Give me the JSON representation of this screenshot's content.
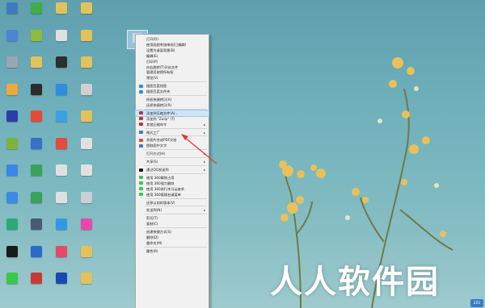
{
  "desktop": {
    "icons": [
      {
        "label": "",
        "color": "#3f7ac0"
      },
      {
        "label": "",
        "color": "#3fae4a"
      },
      {
        "label": "",
        "color": "#e3c25c"
      },
      {
        "label": "",
        "color": "#e3c25c"
      },
      {
        "label": "",
        "color": "#4b86cf"
      },
      {
        "label": "",
        "color": "#8bbd3a"
      },
      {
        "label": "",
        "color": "#e0e0e0"
      },
      {
        "label": "",
        "color": "#e3c25c"
      },
      {
        "label": "",
        "color": "#9aa6b4"
      },
      {
        "label": "",
        "color": "#e3c25c"
      },
      {
        "label": "",
        "color": "#2e2e2e"
      },
      {
        "label": "",
        "color": "#e3c25c"
      },
      {
        "label": "",
        "color": "#f0a73a"
      },
      {
        "label": "",
        "color": "#2b2b2b"
      },
      {
        "label": "",
        "color": "#2d8de0"
      },
      {
        "label": "",
        "color": "#d0d0d0"
      },
      {
        "label": "",
        "color": "#2b3ea8"
      },
      {
        "label": "",
        "color": "#e64a3a"
      },
      {
        "label": "",
        "color": "#3aa0e6"
      },
      {
        "label": "",
        "color": "#e3c25c"
      },
      {
        "label": "",
        "color": "#7fb43a"
      },
      {
        "label": "",
        "color": "#3a70c8"
      },
      {
        "label": "",
        "color": "#e64a3a"
      },
      {
        "label": "",
        "color": "#e0e0e0"
      },
      {
        "label": "",
        "color": "#3a86e6"
      },
      {
        "label": "",
        "color": "#3aa05a"
      },
      {
        "label": "",
        "color": "#e0e0e0"
      },
      {
        "label": "",
        "color": "#e0e0e0"
      },
      {
        "label": "",
        "color": "#3a8ae6"
      },
      {
        "label": "",
        "color": "#3aa05a"
      },
      {
        "label": "",
        "color": "#e0e0e0"
      },
      {
        "label": "",
        "color": "#c8cfd8"
      },
      {
        "label": "",
        "color": "#2ea878"
      },
      {
        "label": "",
        "color": "#4a5a70"
      },
      {
        "label": "",
        "color": "#2e9ae6"
      },
      {
        "label": "",
        "color": "#e64aa8"
      },
      {
        "label": "",
        "color": "#1a1a1a"
      },
      {
        "label": "",
        "color": "#2a6ac8"
      },
      {
        "label": "",
        "color": "#e64a6a"
      },
      {
        "label": "",
        "color": "#e3c25c"
      },
      {
        "label": "",
        "color": "#3ac84a"
      },
      {
        "label": "",
        "color": "#c83a3a"
      },
      {
        "label": "",
        "color": "#1a4ab0"
      },
      {
        "label": "",
        "color": "#e3c25c"
      }
    ]
  },
  "context_menu": {
    "items": [
      {
        "type": "item",
        "label": "打开(O)",
        "icon": "",
        "arrow": false
      },
      {
        "type": "item",
        "label": "使用画图考核审阅(已编辑)",
        "icon": "",
        "arrow": false
      },
      {
        "type": "item",
        "label": "设置为桌面背景(B)",
        "icon": "",
        "arrow": false
      },
      {
        "type": "item",
        "label": "编辑(E)",
        "icon": "",
        "arrow": false
      },
      {
        "type": "item",
        "label": "打印(P)",
        "icon": "",
        "arrow": false
      },
      {
        "type": "item",
        "label": "向右旋转(T)开启文件",
        "icon": "",
        "arrow": false
      },
      {
        "type": "item",
        "label": "管理员取得所有权",
        "icon": "",
        "arrow": false
      },
      {
        "type": "item",
        "label": "预览(V)",
        "icon": "",
        "arrow": false
      },
      {
        "type": "sep"
      },
      {
        "type": "item",
        "label": "搜图百度找图",
        "icon": "#2d8de0",
        "arrow": false
      },
      {
        "type": "item",
        "label": "搜图百度文件夹",
        "icon": "#2d8de0",
        "arrow": false
      },
      {
        "type": "sep"
      },
      {
        "type": "item",
        "label": "授权快捷拷贝(A)",
        "icon": "",
        "arrow": false
      },
      {
        "type": "item",
        "label": "还原快捷拷贝(R)",
        "icon": "",
        "arrow": false
      },
      {
        "type": "sep"
      },
      {
        "type": "item",
        "label": "添加到压缩文件(A)...",
        "icon": "#b03a3a",
        "arrow": false,
        "highlight": true
      },
      {
        "type": "item",
        "label": "添加到 \"Zulip\" (T)",
        "icon": "#b03a3a",
        "arrow": false
      },
      {
        "type": "item",
        "label": "其他压缩命令",
        "icon": "#b03a3a",
        "arrow": true
      },
      {
        "type": "sep"
      },
      {
        "type": "item",
        "label": "格式工厂",
        "icon": "#3a7ac8",
        "arrow": true
      },
      {
        "type": "sep"
      },
      {
        "type": "item",
        "label": "多图片合成PDF文档",
        "icon": "#e64a3a",
        "arrow": false
      },
      {
        "type": "item",
        "label": "提取图中文字",
        "icon": "#3a7ac8",
        "arrow": false
      },
      {
        "type": "sep"
      },
      {
        "type": "item",
        "label": "打开方式(H)",
        "icon": "",
        "arrow": true
      },
      {
        "type": "sep"
      },
      {
        "type": "item",
        "label": "共享(S)",
        "icon": "",
        "arrow": true
      },
      {
        "type": "sep"
      },
      {
        "type": "item",
        "label": "通过QQ发送到",
        "icon": "#1a1a1a",
        "arrow": true
      },
      {
        "type": "sep"
      },
      {
        "type": "item",
        "label": "使用 360解除占用",
        "icon": "#3ac84a",
        "arrow": false
      },
      {
        "type": "item",
        "label": "使用 360强力删除",
        "icon": "#3ac84a",
        "arrow": false
      },
      {
        "type": "item",
        "label": "使用 360进行木马云查杀",
        "icon": "#3ac84a",
        "arrow": false
      },
      {
        "type": "item",
        "label": "使用 360管理右键菜单",
        "icon": "#3ac84a",
        "arrow": false
      },
      {
        "type": "sep"
      },
      {
        "type": "item",
        "label": "还原以前的版本(V)",
        "icon": "",
        "arrow": false
      },
      {
        "type": "sep"
      },
      {
        "type": "item",
        "label": "发送到(N)",
        "icon": "",
        "arrow": true
      },
      {
        "type": "sep"
      },
      {
        "type": "item",
        "label": "剪切(T)",
        "icon": "",
        "arrow": false
      },
      {
        "type": "item",
        "label": "复制(C)",
        "icon": "",
        "arrow": false
      },
      {
        "type": "sep"
      },
      {
        "type": "item",
        "label": "创建快捷方式(S)",
        "icon": "",
        "arrow": false
      },
      {
        "type": "item",
        "label": "删除(D)",
        "icon": "",
        "arrow": false
      },
      {
        "type": "item",
        "label": "重命名(M)",
        "icon": "",
        "arrow": false
      },
      {
        "type": "sep"
      },
      {
        "type": "item",
        "label": "属性(R)",
        "icon": "",
        "arrow": false
      }
    ]
  },
  "selected_file": {
    "label": "2021"
  },
  "watermark": {
    "text": "人人软件园"
  },
  "taskbar": {
    "notify_text": "ZZG"
  },
  "colors": {
    "arrow": "#e23a3a",
    "menu_bg": "#f1f1f1",
    "highlight": "#cfe4f6"
  }
}
